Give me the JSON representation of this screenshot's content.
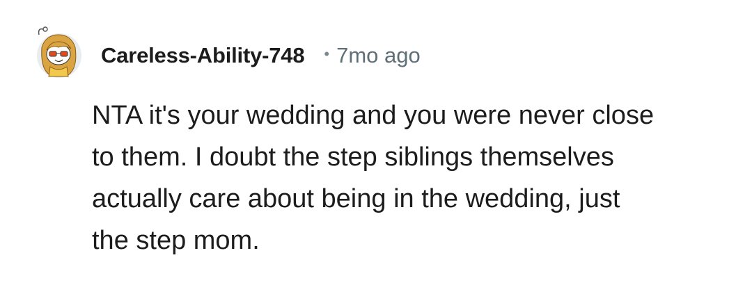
{
  "comment": {
    "avatar_icon": "snoo-avatar-icon",
    "username": "Careless-Ability-748",
    "separator": "•",
    "timestamp": "7mo ago",
    "body_lines": [
      "NTA it's your wedding and you were never close",
      "to them. I doubt the step siblings themselves",
      "actually care about being in the wedding, just",
      "the step mom."
    ]
  },
  "colors": {
    "text_primary": "#1c1c1c",
    "text_meta": "#5f6f78",
    "background": "#ffffff",
    "avatar_bg": "#e9ecee",
    "avatar_hair": "#d9a441",
    "avatar_glasses": "#e24a1a"
  }
}
